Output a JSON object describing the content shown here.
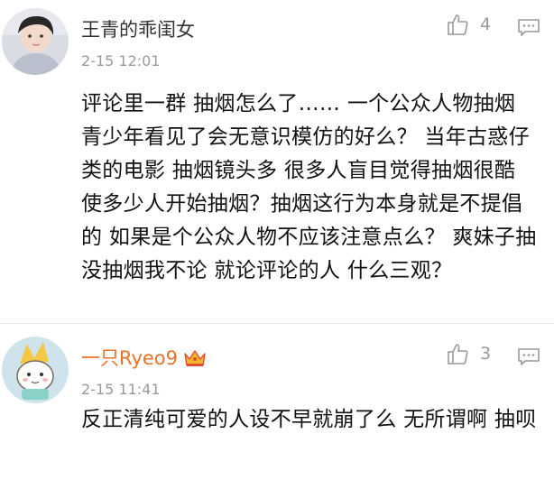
{
  "comments": [
    {
      "username": "王青的乖闺女",
      "timestamp": "2-15 12:01",
      "like_count": "4",
      "text": "评论里一群 抽烟怎么了…… 一个公众人物抽烟 青少年看见了会无意识模仿的好么？ 当年古惑仔类的电影 抽烟镜头多 很多人盲目觉得抽烟很酷 使多少人开始抽烟？抽烟这行为本身就是不提倡的 如果是个公众人物不应该注意点么？ 爽妹子抽没抽烟我不论 就论评论的人 什么三观？",
      "avatar": "user-avatar-photo"
    },
    {
      "username": "一只Ryeo9",
      "timestamp": "2-15 11:41",
      "like_count": "3",
      "text": "反正清纯可爱的人设不早就崩了么 无所谓啊 抽呗",
      "avatar": "cartoon-avatar",
      "badge": "crown-icon"
    }
  ],
  "colors": {
    "vip_name": "#e8732a",
    "meta": "#999999",
    "divider": "#e8e8e8"
  }
}
